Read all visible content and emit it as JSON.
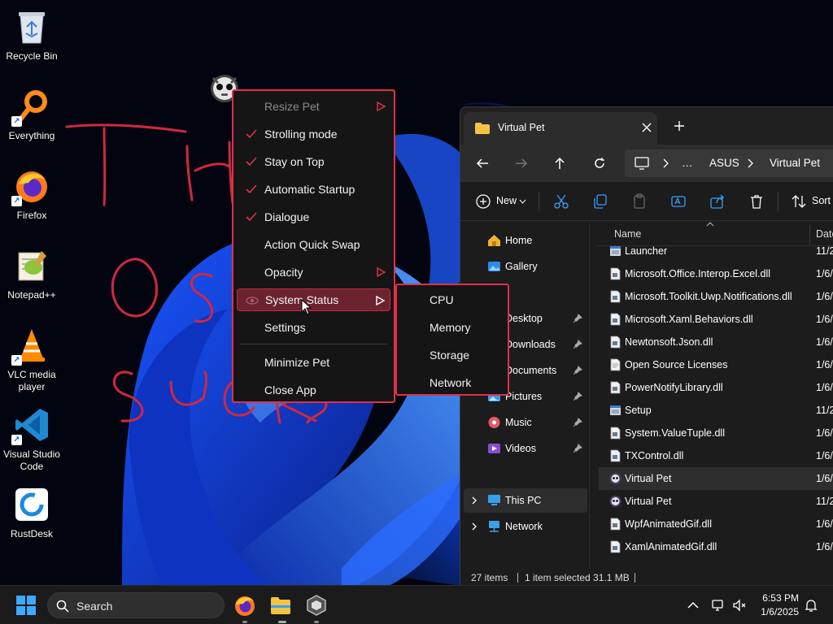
{
  "desktop": {
    "icons": [
      {
        "label": "Recycle Bin",
        "icon": "recycle-bin-icon"
      },
      {
        "label": "Everything",
        "icon": "everything-search-icon"
      },
      {
        "label": "Firefox",
        "icon": "firefox-icon"
      },
      {
        "label": "Notepad++",
        "icon": "notepad-plus-plus-icon"
      },
      {
        "label": "VLC media player",
        "icon": "vlc-icon"
      },
      {
        "label": "Visual Studio Code",
        "icon": "vscode-icon"
      },
      {
        "label": "RustDesk",
        "icon": "rustdesk-icon"
      }
    ],
    "handwriting": "THIS OS SUCKS"
  },
  "context_menu": {
    "items": [
      {
        "label": "Resize Pet",
        "checked": false,
        "submenu": true,
        "disabled": true
      },
      {
        "label": "Strolling mode",
        "checked": true
      },
      {
        "label": "Stay on Top",
        "checked": true
      },
      {
        "label": "Automatic Startup",
        "checked": true
      },
      {
        "label": "Dialogue",
        "checked": true
      },
      {
        "label": "Action Quick Swap",
        "checked": false
      },
      {
        "label": "Opacity",
        "checked": false,
        "submenu": true
      },
      {
        "label": "System Status",
        "checked": false,
        "submenu": true,
        "highlighted": true
      },
      {
        "label": "Settings",
        "checked": false
      },
      {
        "label": "Minimize Pet",
        "checked": false
      },
      {
        "label": "Close App",
        "checked": false
      }
    ],
    "submenu_items": [
      "CPU",
      "Memory",
      "Storage",
      "Network"
    ],
    "accent_color": "#e0304a"
  },
  "explorer": {
    "tab_title": "Virtual Pet",
    "breadcrumb": [
      "…",
      "ASUS",
      "Virtual Pet"
    ],
    "toolbar": {
      "new_label": "New",
      "sort_label": "Sort"
    },
    "nav": [
      {
        "label": "Home",
        "icon": "home-icon"
      },
      {
        "label": "Gallery",
        "icon": "gallery-icon"
      },
      {
        "label": "Desktop",
        "icon": "desktop-folder-icon",
        "pinned": true
      },
      {
        "label": "Downloads",
        "icon": "downloads-folder-icon",
        "pinned": true
      },
      {
        "label": "Documents",
        "icon": "documents-folder-icon",
        "pinned": true
      },
      {
        "label": "Pictures",
        "icon": "pictures-folder-icon",
        "pinned": true
      },
      {
        "label": "Music",
        "icon": "music-folder-icon",
        "pinned": true
      },
      {
        "label": "Videos",
        "icon": "videos-folder-icon",
        "pinned": true
      },
      {
        "label": "This PC",
        "icon": "this-pc-icon",
        "expandable": true,
        "selected": true
      },
      {
        "label": "Network",
        "icon": "network-icon",
        "expandable": true
      }
    ],
    "columns": {
      "name": "Name",
      "date": "Date"
    },
    "files": [
      {
        "name": "Launcher",
        "date": "11/2",
        "icon": "app-icon"
      },
      {
        "name": "Microsoft.Office.Interop.Excel.dll",
        "date": "1/6/",
        "icon": "dll-icon"
      },
      {
        "name": "Microsoft.Toolkit.Uwp.Notifications.dll",
        "date": "1/6/",
        "icon": "dll-icon"
      },
      {
        "name": "Microsoft.Xaml.Behaviors.dll",
        "date": "1/6/",
        "icon": "dll-icon"
      },
      {
        "name": "Newtonsoft.Json.dll",
        "date": "1/6/",
        "icon": "dll-icon"
      },
      {
        "name": "Open Source Licenses",
        "date": "1/6/",
        "icon": "text-file-icon"
      },
      {
        "name": "PowerNotifyLibrary.dll",
        "date": "1/6/",
        "icon": "dll-icon"
      },
      {
        "name": "Setup",
        "date": "11/2",
        "icon": "app-icon"
      },
      {
        "name": "System.ValueTuple.dll",
        "date": "1/6/",
        "icon": "dll-icon"
      },
      {
        "name": "TXControl.dll",
        "date": "1/6/",
        "icon": "dll-icon"
      },
      {
        "name": "Virtual Pet",
        "date": "1/6/",
        "icon": "pet-app-icon",
        "selected": true
      },
      {
        "name": "Virtual Pet",
        "date": "11/2",
        "icon": "pet-app-icon"
      },
      {
        "name": "WpfAnimatedGif.dll",
        "date": "1/6/",
        "icon": "dll-icon"
      },
      {
        "name": "XamlAnimatedGif.dll",
        "date": "1/6/",
        "icon": "dll-icon"
      }
    ],
    "status": {
      "count": "27 items",
      "selection": "1 item selected  31.1 MB"
    }
  },
  "taskbar": {
    "search_placeholder": "Search",
    "time": "6:53 PM",
    "date": "1/6/2025"
  }
}
